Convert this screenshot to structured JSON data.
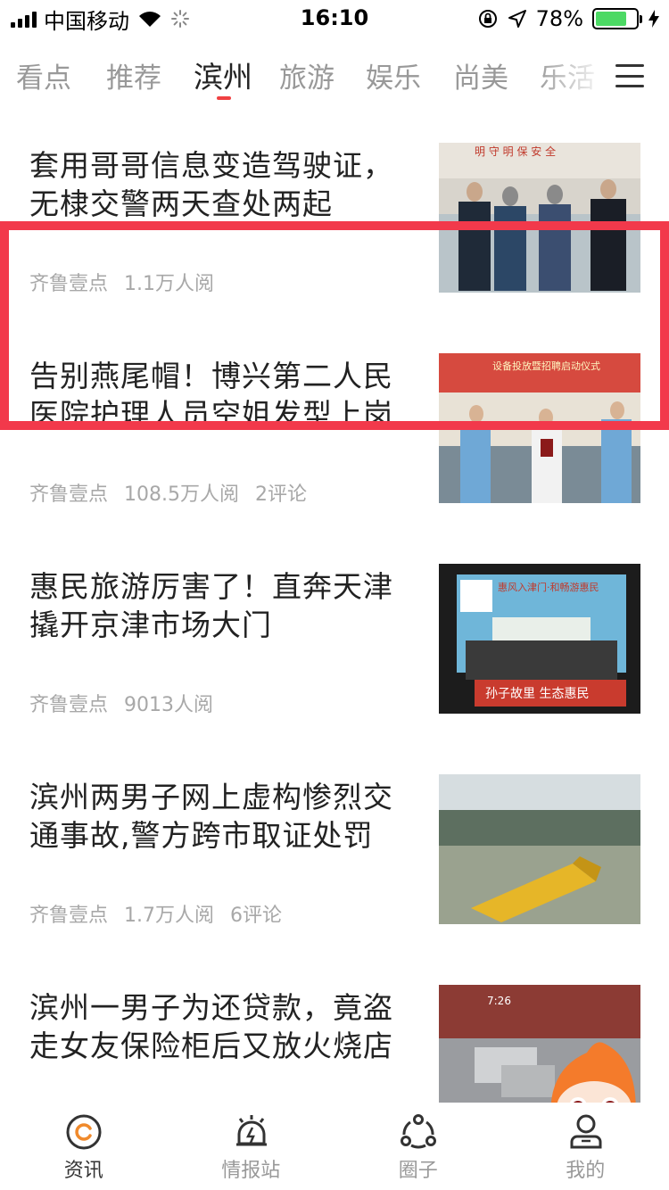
{
  "status_bar": {
    "carrier": "中国移动",
    "time": "16:10",
    "battery_percent": "78%",
    "battery_level": 0.78
  },
  "tabs": [
    {
      "label": "看点"
    },
    {
      "label": "推荐"
    },
    {
      "label": "滨州"
    },
    {
      "label": "旅游"
    },
    {
      "label": "娱乐"
    },
    {
      "label": "尚美"
    },
    {
      "label": "乐活"
    }
  ],
  "active_tab": "滨州",
  "feed": [
    {
      "title": "套用哥哥信息变造驾驶证，无棣交警两天查处两起",
      "source": "齐鲁壹点",
      "reads": "1.1万人阅",
      "comments": ""
    },
    {
      "title": "告别燕尾帽！博兴第二人民医院护理人员空姐发型上岗",
      "source": "齐鲁壹点",
      "reads": "108.5万人阅",
      "comments": "2评论"
    },
    {
      "title": "惠民旅游厉害了！直奔天津撬开京津市场大门",
      "source": "齐鲁壹点",
      "reads": "9013人阅",
      "comments": ""
    },
    {
      "title": "滨州两男子网上虚构惨烈交通事故,警方跨市取证处罚",
      "source": "齐鲁壹点",
      "reads": "1.7万人阅",
      "comments": "6评论"
    },
    {
      "title": "滨州一男子为还贷款，竟盗走女友保险柜后又放火烧店",
      "source": "",
      "reads": "",
      "comments": ""
    }
  ],
  "thumb_text": {
    "item1_banner": "明 守 明 保 安 全",
    "item2_banner": "设备投放暨招聘启动仪式",
    "item3_banner_top": "惠风入津门·和畅游惠民",
    "item3_banner_bottom": "孙子故里 生态惠民",
    "item5_time": "7:26"
  },
  "bottom_nav": [
    {
      "label": "资讯",
      "icon": "news-icon"
    },
    {
      "label": "情报站",
      "icon": "intel-station-icon"
    },
    {
      "label": "圈子",
      "icon": "circle-icon"
    },
    {
      "label": "我的",
      "icon": "profile-icon"
    }
  ],
  "colors": {
    "accent": "#f04142",
    "highlight_border": "#f2394b",
    "battery": "#4cd964",
    "nav_active": "#f08a2c"
  }
}
